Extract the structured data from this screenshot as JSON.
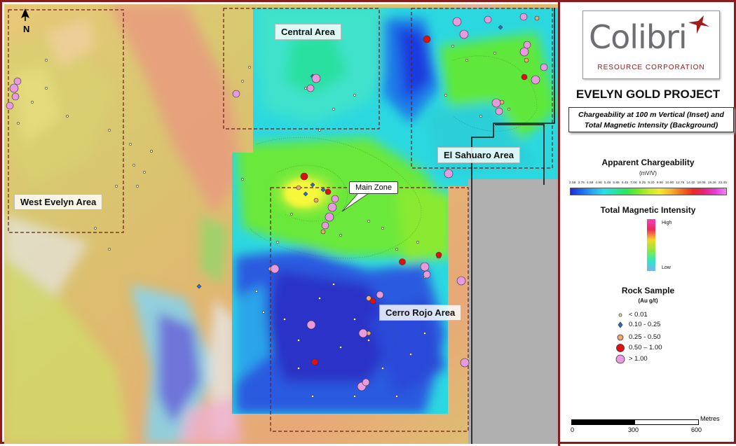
{
  "map": {
    "north_label": "N",
    "areas": {
      "central": "Central Area",
      "el_sahuaro": "El Sahuaro Area",
      "west_evelyn": "West Evelyn Area",
      "cerro_rojo": "Cerro Rojo Area"
    },
    "callout": "Main Zone"
  },
  "legend": {
    "logo_word": "Colibri",
    "logo_sub": "RESOURCE CORPORATION",
    "project_title": "EVELYN GOLD PROJECT",
    "subtitle_line1": "Chargeability at 100 m Vertical (Inset) and",
    "subtitle_line2": "Total Magnetic Intensity (Background)",
    "chargeability_title": "Apparent Chargeability",
    "chargeability_unit": "(mV/V)",
    "chargeability_ticks": [
      "2.56",
      "3.76",
      "4.58",
      "4.96",
      "5.48",
      "5.85",
      "6.45",
      "7.06",
      "8.25",
      "9.20",
      "9.90",
      "10.90",
      "12.75",
      "14.40",
      "18.05",
      "19.26",
      "23.45"
    ],
    "tmi_title": "Total Magnetic Intensity",
    "tmi_high": "High",
    "tmi_low": "Low",
    "rock_title": "Rock Sample",
    "rock_unit": "(Au g/t)",
    "rock_classes": [
      {
        "label": "< 0.01",
        "color": "#e8e8c0",
        "icon": "dot-icon"
      },
      {
        "label": "0.10 - 0.25",
        "color": "#2a6fd6",
        "icon": "diamond-icon"
      },
      {
        "label": "0.25 - 0.50",
        "color": "#f2a86a",
        "icon": "circle-icon"
      },
      {
        "label": "0.50 – 1.00",
        "color": "#e01010",
        "icon": "circle-icon"
      },
      {
        "label": "> 1.00",
        "color": "#e89ae0",
        "icon": "circle-icon"
      }
    ],
    "scale_unit": "Metres",
    "scale_labels": [
      "0",
      "300",
      "600"
    ],
    "colors": {
      "brand": "#8b1a1a",
      "logo_grey": "#6d6e71"
    }
  }
}
